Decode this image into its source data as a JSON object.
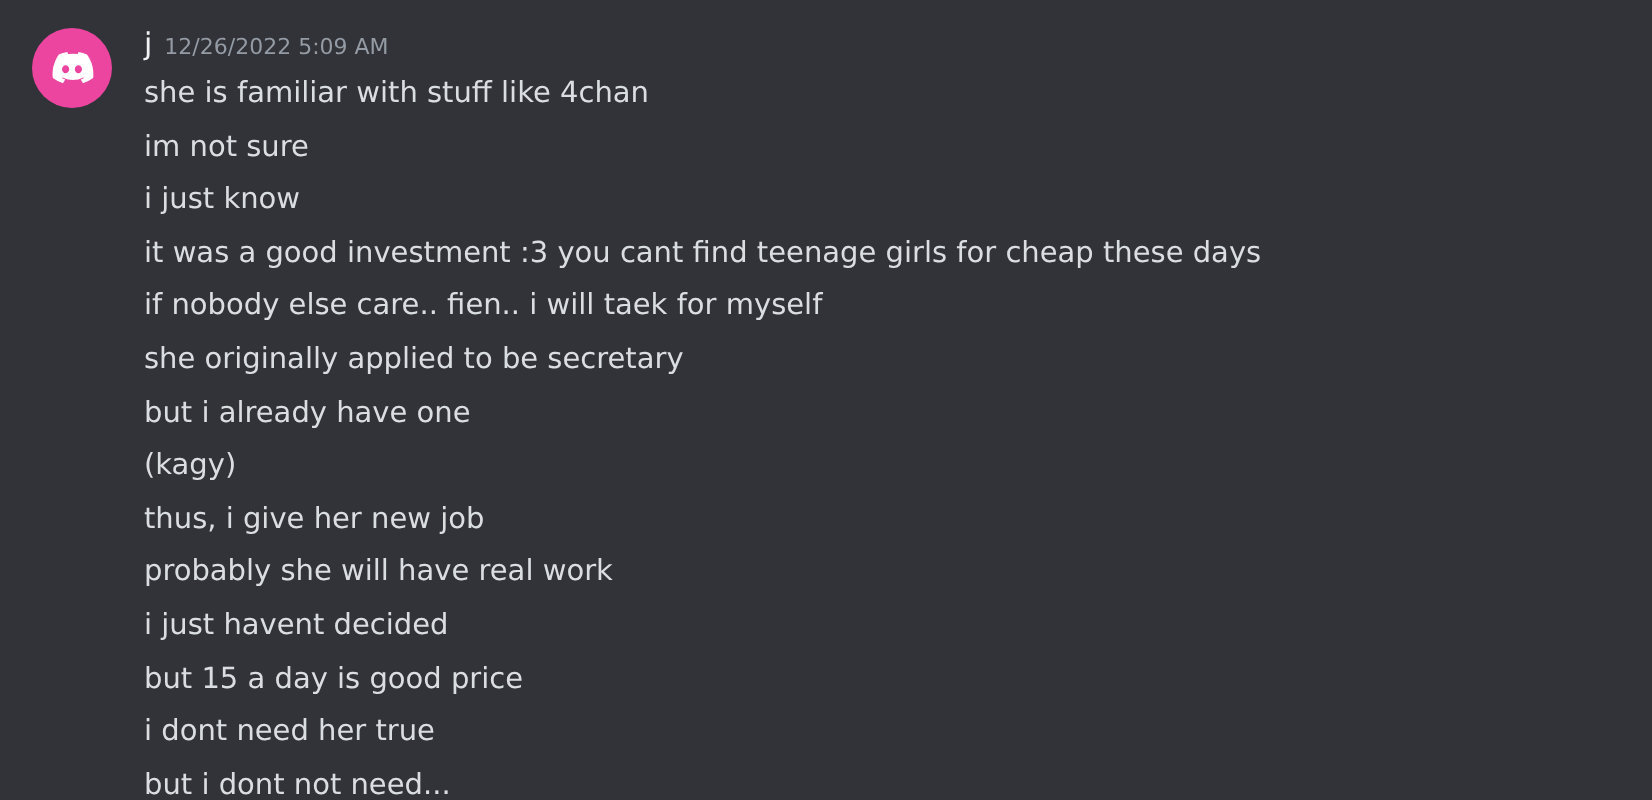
{
  "message": {
    "author": "j",
    "timestamp": "12/26/2022 5:09 AM",
    "lines": [
      "she is familiar with stuff like 4chan",
      "im not sure",
      "i just know",
      "it was a good investment :3 you cant find teenage girls for cheap these days",
      "if nobody else care.. fien.. i will taek for myself",
      "she originally applied to be secretary",
      "but i already have one",
      "(kagy)",
      "thus, i give her new job",
      "probably she will have real work",
      "i just havent decided",
      "but 15 a day is good price",
      "i dont need her true",
      "but i dont not need..."
    ]
  }
}
